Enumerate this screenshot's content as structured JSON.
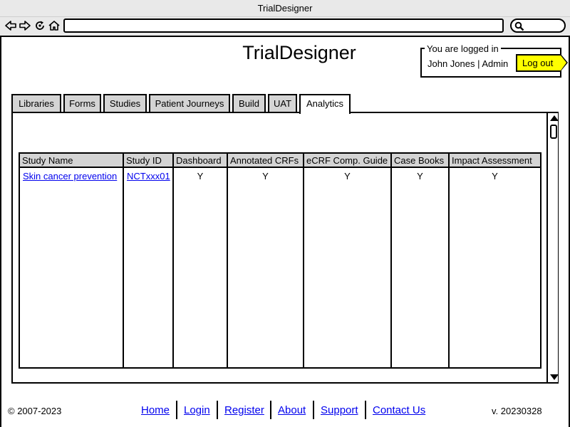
{
  "window": {
    "title": "TrialDesigner"
  },
  "browser": {
    "icons": [
      "back-icon",
      "forward-icon",
      "reload-icon",
      "home-icon",
      "search-icon"
    ],
    "url": ""
  },
  "header": {
    "app_title": "TrialDesigner",
    "login_legend": "You are logged in",
    "user": "John Jones | Admin",
    "logout_label": "Log out",
    "logout_color": "#ffff00"
  },
  "tabs": [
    {
      "label": "Libraries",
      "active": false
    },
    {
      "label": "Forms",
      "active": false
    },
    {
      "label": "Studies",
      "active": false
    },
    {
      "label": "Patient Journeys",
      "active": false
    },
    {
      "label": "Build",
      "active": false
    },
    {
      "label": "UAT",
      "active": false
    },
    {
      "label": "Analytics",
      "active": true
    }
  ],
  "table": {
    "columns": [
      "Study Name",
      "Study ID",
      "Dashboard",
      "Annotated CRFs",
      "eCRF Comp. Guide",
      "Case Books",
      "Impact Assessment"
    ],
    "rows": [
      [
        "Skin cancer prevention",
        "NCTxxx01",
        "Y",
        "Y",
        "Y",
        "Y",
        "Y"
      ]
    ]
  },
  "footer": {
    "copyright": "© 2007-2023",
    "links": [
      "Home",
      "Login",
      "Register",
      "About",
      "Support",
      "Contact Us"
    ],
    "version": "v. 20230328",
    "link_color": "#0000ee"
  }
}
